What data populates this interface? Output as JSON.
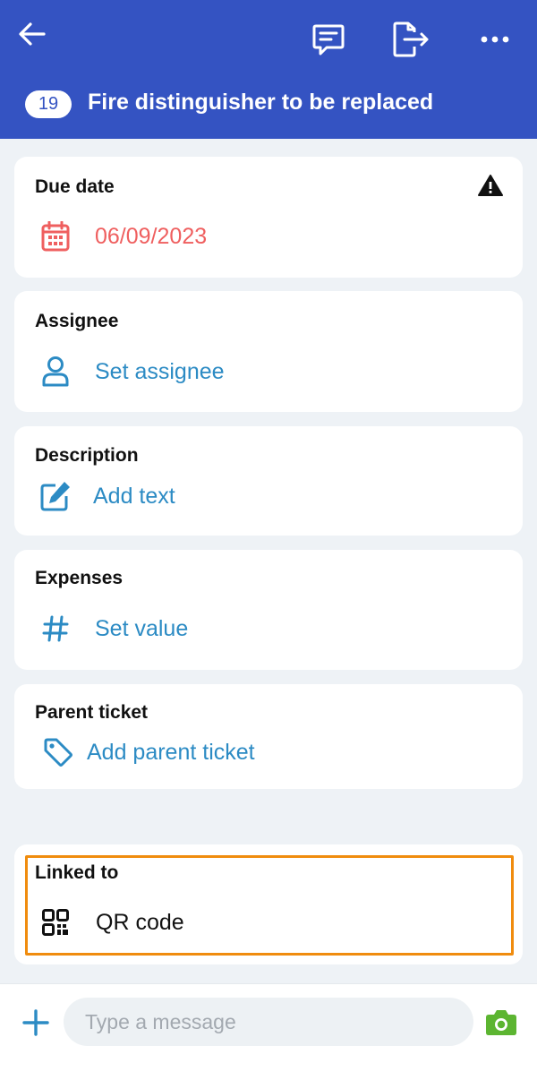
{
  "header": {
    "ticket_number": "19",
    "title": "Fire distinguisher to be replaced",
    "icons": [
      "back-arrow-icon",
      "comment-icon",
      "export-icon",
      "more-icon"
    ]
  },
  "cards": {
    "due_date": {
      "label": "Due date",
      "value": "06/09/2023",
      "icon": "calendar-icon",
      "warning_icon": "warning-icon"
    },
    "assignee": {
      "label": "Assignee",
      "value": "Set assignee",
      "icon": "user-icon"
    },
    "description": {
      "label": "Description",
      "value": "Add text",
      "icon": "edit-icon"
    },
    "expenses": {
      "label": "Expenses",
      "value": "Set value",
      "icon": "hash-icon"
    },
    "parent_ticket": {
      "label": "Parent ticket",
      "value": "Add parent ticket",
      "icon": "tag-icon"
    },
    "linked_to": {
      "label": "Linked to",
      "value": "QR code",
      "icon": "qr-code-icon"
    }
  },
  "composer": {
    "placeholder": "Type a message",
    "icons": [
      "plus-icon",
      "camera-icon"
    ]
  },
  "colors": {
    "header_bg": "#3453c2",
    "accent_blue": "#2c8bc4",
    "overdue_red": "#ef5f5f",
    "highlight_orange": "#f08c0e",
    "camera_green": "#5cb531"
  }
}
